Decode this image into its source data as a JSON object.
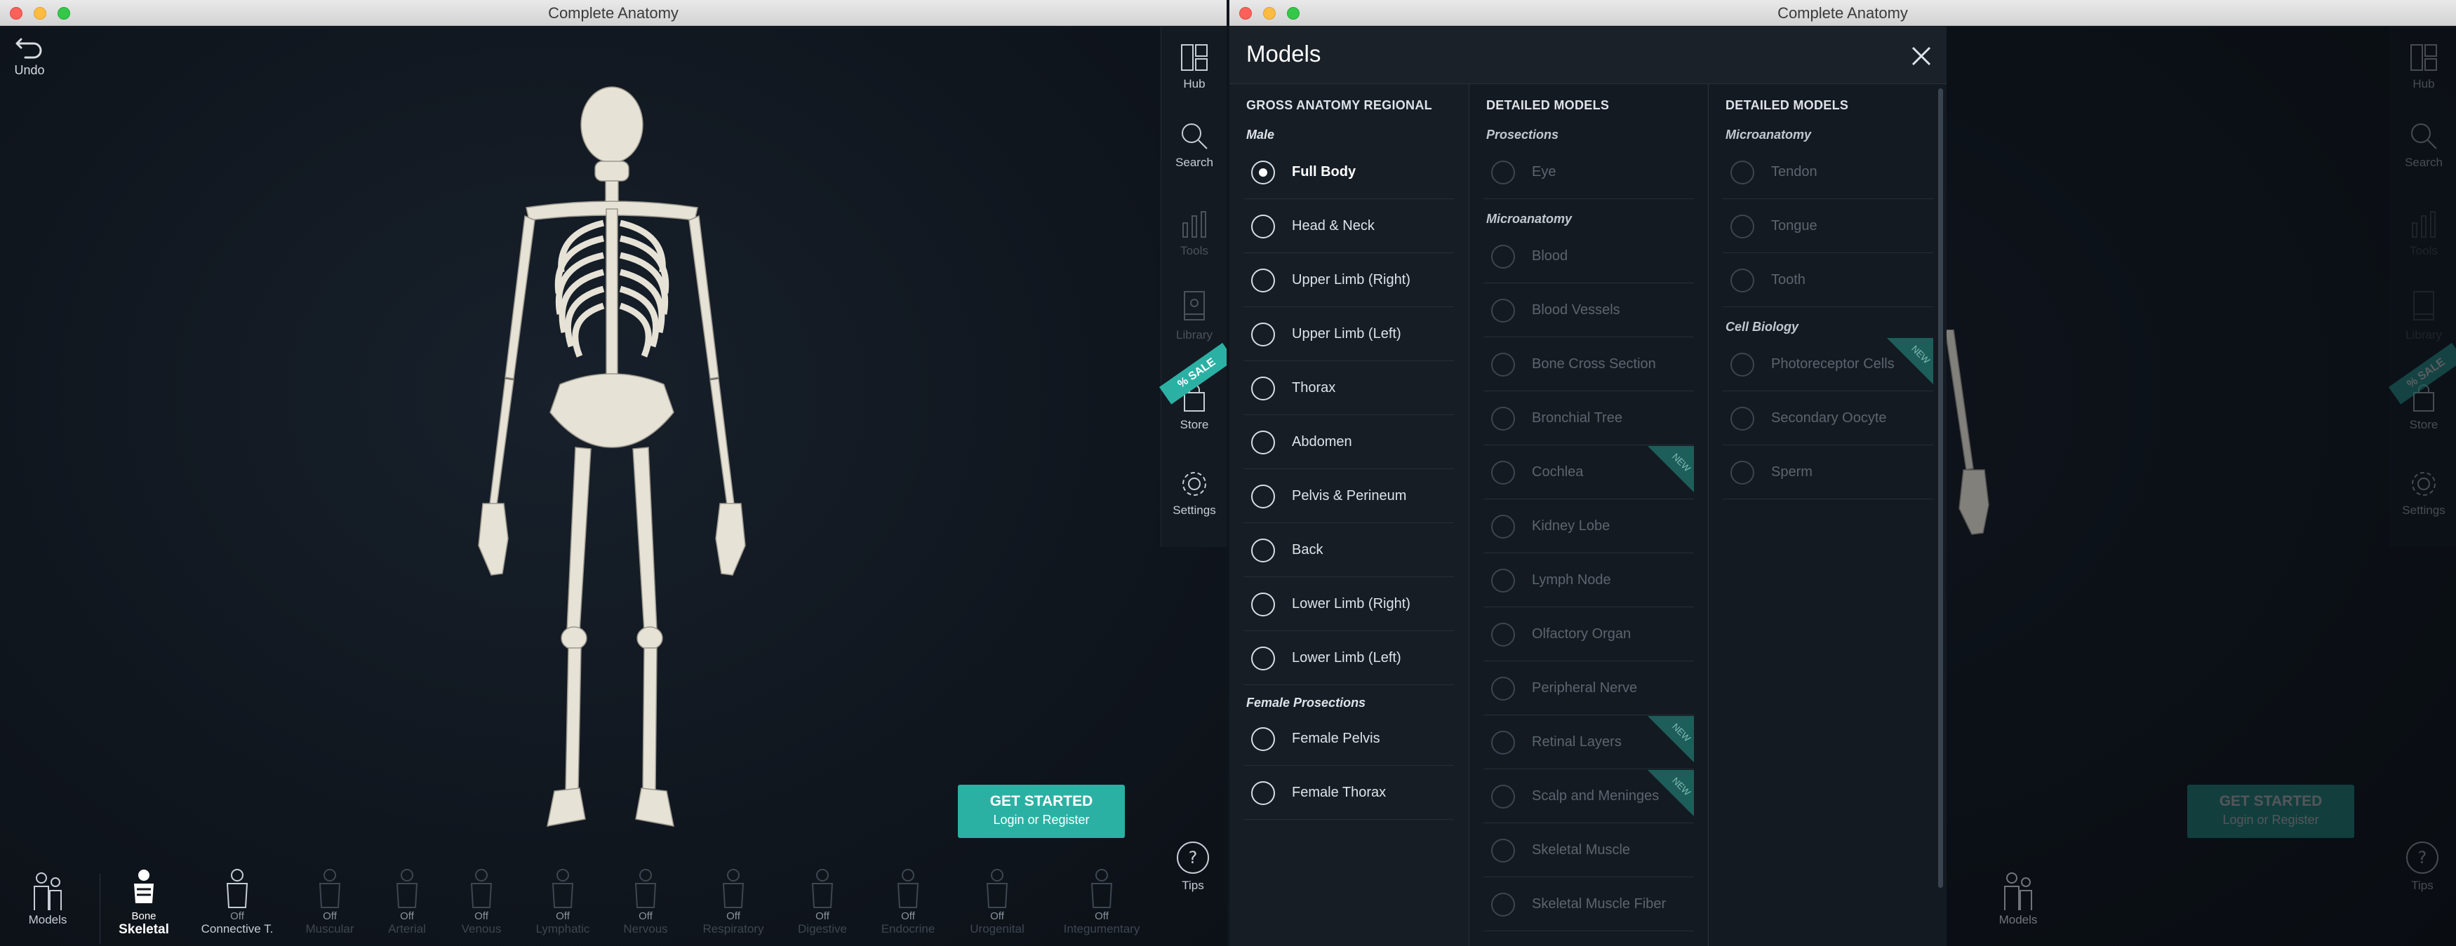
{
  "window_title": "Complete Anatomy",
  "undo_label": "Undo",
  "rail": {
    "hub": "Hub",
    "search": "Search",
    "tools": "Tools",
    "library": "Library",
    "store": "Store",
    "settings": "Settings",
    "sale": "% SALE"
  },
  "tips": "Tips",
  "cta": {
    "line1": "GET STARTED",
    "line2": "Login or Register"
  },
  "bottom": {
    "models": "Models",
    "skeletal_sub": "Bone",
    "skeletal_main": "Skeletal",
    "connective_sub": "Off",
    "connective_main": "Connective T.",
    "systems": [
      {
        "sub": "Off",
        "main": "Muscular"
      },
      {
        "sub": "Off",
        "main": "Arterial"
      },
      {
        "sub": "Off",
        "main": "Venous"
      },
      {
        "sub": "Off",
        "main": "Lymphatic"
      },
      {
        "sub": "Off",
        "main": "Nervous"
      },
      {
        "sub": "Off",
        "main": "Respiratory"
      },
      {
        "sub": "Off",
        "main": "Digestive"
      },
      {
        "sub": "Off",
        "main": "Endocrine"
      },
      {
        "sub": "Off",
        "main": "Urogenital"
      },
      {
        "sub": "Off",
        "main": "Integumentary"
      }
    ]
  },
  "panel": {
    "title": "Models",
    "col1": {
      "header": "GROSS ANATOMY REGIONAL",
      "group_male": "Male",
      "items": [
        "Full Body",
        "Head & Neck",
        "Upper Limb (Right)",
        "Upper Limb (Left)",
        "Thorax",
        "Abdomen",
        "Pelvis & Perineum",
        "Back",
        "Lower Limb (Right)",
        "Lower Limb (Left)"
      ],
      "group_female": "Female Prosections",
      "female_items": [
        "Female Pelvis",
        "Female Thorax"
      ]
    },
    "col2": {
      "header": "DETAILED MODELS",
      "group_prosections": "Prosections",
      "prosection_items": [
        "Eye"
      ],
      "group_micro": "Microanatomy",
      "micro_items": [
        "Blood",
        "Blood Vessels",
        "Bone Cross Section",
        "Bronchial Tree",
        "Cochlea",
        "Kidney Lobe",
        "Lymph Node",
        "Olfactory Organ",
        "Peripheral Nerve",
        "Retinal Layers",
        "Scalp and Meninges",
        "Skeletal Muscle",
        "Skeletal Muscle Fiber"
      ],
      "new_tag": "NEW"
    },
    "col3": {
      "header": "DETAILED MODELS",
      "group_micro": "Microanatomy",
      "micro_items": [
        "Tendon",
        "Tongue",
        "Tooth"
      ],
      "group_cell": "Cell Biology",
      "cell_items": [
        "Photoreceptor Cells",
        "Secondary Oocyte",
        "Sperm"
      ]
    }
  }
}
